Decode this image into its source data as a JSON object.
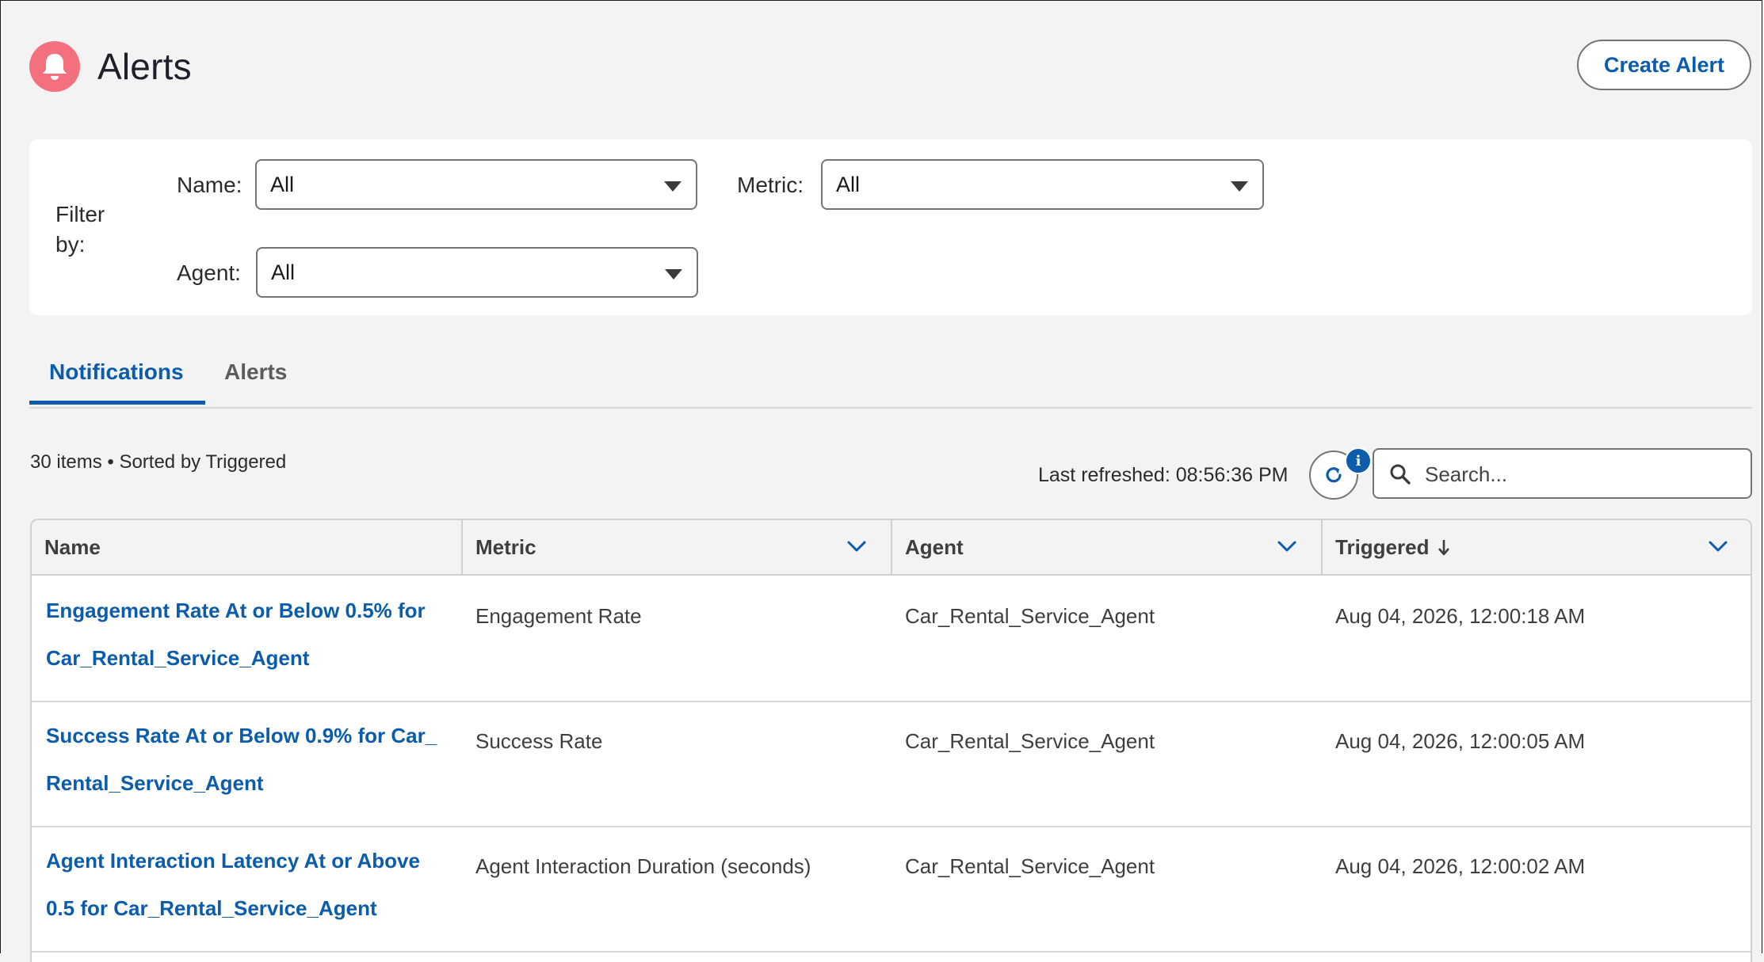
{
  "header": {
    "title": "Alerts",
    "create_button": "Create Alert"
  },
  "filters": {
    "filter_by_label": "Filter by:",
    "name_label": "Name:",
    "name_value": "All",
    "metric_label": "Metric:",
    "metric_value": "All",
    "agent_label": "Agent:",
    "agent_value": "All"
  },
  "tabs": [
    {
      "label": "Notifications",
      "active": true
    },
    {
      "label": "Alerts",
      "active": false
    }
  ],
  "toolbar": {
    "items_info": "30 items • Sorted by Triggered",
    "last_refreshed": "Last refreshed: 08:56:36 PM",
    "info_badge": "i",
    "search_placeholder": "Search..."
  },
  "table": {
    "columns": [
      "Name",
      "Metric",
      "Agent",
      "Triggered"
    ],
    "rows": [
      {
        "name_line1": "Engagement Rate At or Below 0.5% for",
        "name_line2": "Car_Rental_Service_Agent",
        "metric": "Engagement Rate",
        "agent": "Car_Rental_Service_Agent",
        "triggered": "Aug 04, 2026, 12:00:18 AM"
      },
      {
        "name_line1": "Success Rate At or Below 0.9% for Car_",
        "name_line2": "Rental_Service_Agent",
        "metric": "Success Rate",
        "agent": "Car_Rental_Service_Agent",
        "triggered": "Aug 04, 2026, 12:00:05 AM"
      },
      {
        "name_line1": "Agent Interaction Latency At or Above",
        "name_line2": "0.5 for Car_Rental_Service_Agent",
        "metric": "Agent Interaction Duration (seconds)",
        "agent": "Car_Rental_Service_Agent",
        "triggered": "Aug 04, 2026, 12:00:02 AM"
      }
    ]
  },
  "colors": {
    "accent": "#0b5cab",
    "header_icon_bg": "#f4707f",
    "page_bg": "#f3f3f3"
  }
}
